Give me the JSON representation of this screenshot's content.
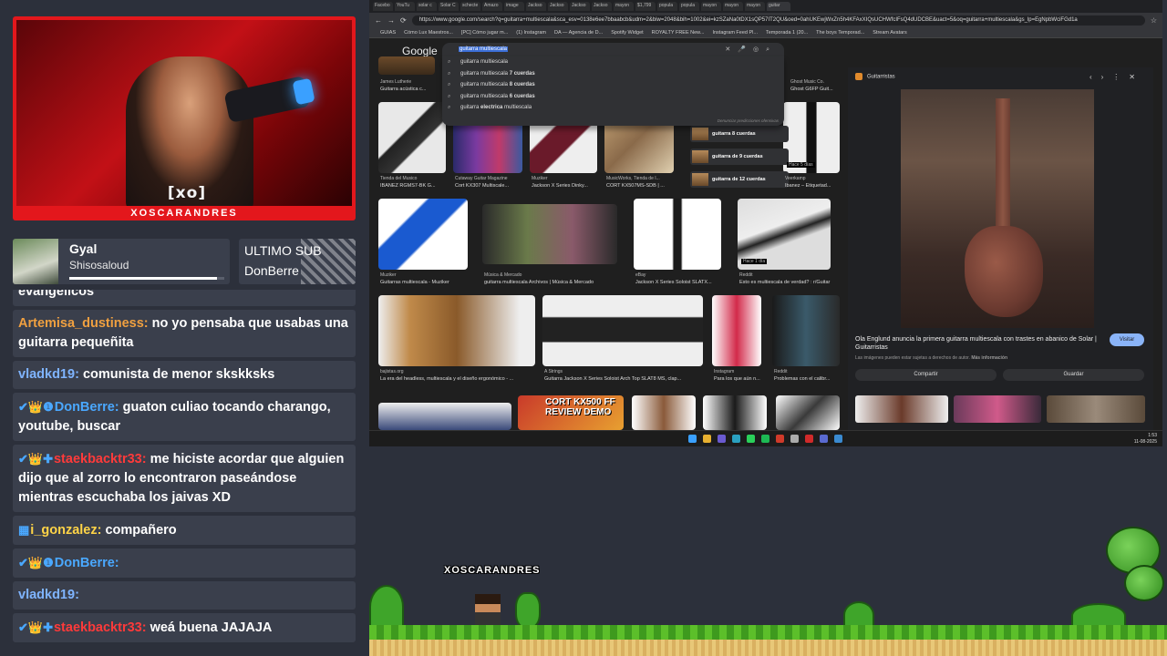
{
  "webcam": {
    "logo": "[xo]",
    "channel_name": "XOSCARANDRES"
  },
  "follow": {
    "label": "Gyal",
    "name": "Shisosaloud",
    "progress": 0.95
  },
  "last_sub": {
    "title": "ULTIMO SUB",
    "name": "DonBerre"
  },
  "chat": [
    {
      "user": "",
      "text": "evangelicos",
      "color": "#ffffff",
      "badges": ""
    },
    {
      "user": "Artemisa_dustiness:",
      "text": "no yo pensaba que usabas una guitarra pequeñita",
      "color": "#f0a040",
      "badges": ""
    },
    {
      "user": "vladkd19:",
      "text": "comunista de menor skskksks",
      "color": "#7fb4ff",
      "badges": ""
    },
    {
      "user": "DonBerre:",
      "text": "guaton culiao tocando charango, youtube, buscar",
      "color": "#4aa8ff",
      "badges": "✔👑❶"
    },
    {
      "user": "staekbacktr33:",
      "text": "me hiciste acordar que alguien dijo que al zorro lo encontraron paseándose mientras escuchaba los jaivas XD",
      "color": "#ff3a3a",
      "badges": "✔👑✚"
    },
    {
      "user": "i_gonzalez:",
      "text": "compañero",
      "color": "#ffd447",
      "badges": "▦"
    },
    {
      "user": "DonBerre:",
      "text": "",
      "color": "#4aa8ff",
      "badges": "✔👑❶"
    },
    {
      "user": "vladkd19:",
      "text": "",
      "color": "#7fb4ff",
      "badges": ""
    },
    {
      "user": "staekbacktr33:",
      "text": "weá buena JAJAJA",
      "color": "#ff3a3a",
      "badges": "✔👑✚"
    }
  ],
  "browser": {
    "tabs": [
      "Facebo",
      "YouTu",
      "solar c",
      "Solar C",
      "schecte",
      "Amazo",
      "image",
      "Jackso",
      "Jackso",
      "Jackso",
      "Jackso",
      "mayon",
      "$1,799",
      "popula",
      "popula",
      "mayon",
      "mayon",
      "mayon",
      "guitar"
    ],
    "url": "https://www.google.com/search?q=guitarra+multiescala&sca_esv=0138e6ee7bbaabcb&udm=2&biw=2048&bih=1002&ei=kzSZaNa0tDX1sQP57IT2QU&oed=0ahUKEwjWxZn5h4KFAxXIQsUCHWfcIFsQ4dUDCBE&uact=5&oq=guitarra+multiescala&gs_lp=EgNpbWciFGd1a",
    "bookmarks": [
      "GUIAS",
      "Cómo Lux Maestros...",
      "[PC] Cómo jugar m...",
      "(1) Instagram",
      "DA — Agencia de D...",
      "Spotify Widget",
      "ROYALTY FREE New...",
      "Instagram Feed Pl...",
      "Temporada 1 (20...",
      "The boys Temporad...",
      "Stream Avatars"
    ],
    "google_logo": "Google",
    "query": "guitarra multiescala",
    "suggestions": [
      {
        "pre": "guitarra multiescala",
        "bold": ""
      },
      {
        "pre": "guitarra multiescala ",
        "bold": "7 cuerdas"
      },
      {
        "pre": "guitarra multiescala ",
        "bold": "8 cuerdas"
      },
      {
        "pre": "guitarra multiescala ",
        "bold": "6 cuerdas"
      },
      {
        "pre": "guitarra ",
        "bold": "electrica",
        "post": " multiescala"
      }
    ],
    "suggestion_footer": "Denunciar predicciones ofensivas",
    "side_chips": [
      "guitarra 8 cuerdas",
      "guitarra de 9 cuerdas",
      "guitarra de 12 cuerdas"
    ],
    "results": [
      {
        "source": "James Lutherie",
        "title": "Guitarra acústica c..."
      },
      {
        "source": "Ghost Music Co.",
        "title": "Ghost G6FP Guit..."
      },
      {
        "source": "Tienda del Musico",
        "title": "IBANEZ RGMS7-BK G..."
      },
      {
        "source": "Cutaway Guitar Magazine",
        "title": "Cort KX307 Multiscale..."
      },
      {
        "source": "Muziker",
        "title": "Jackson X Series Dinky..."
      },
      {
        "source": "MusicWorks, Tienda de I...",
        "title": "CORT KX507MS-SDB | ..."
      },
      {
        "source": "Veerkamp",
        "title": "Ibanez – Etiquetad..."
      },
      {
        "source": "Muziker",
        "title": "Guitarras multiescala - Muziker"
      },
      {
        "source": "Música & Mercado",
        "title": "guitarra multiescala Archivos | Música & Mercado"
      },
      {
        "source": "eBay",
        "title": "Jackson X Series Soloist SLATX..."
      },
      {
        "source": "Reddit",
        "title": "Esto es multiescala de verdad? : r/Guitar"
      },
      {
        "source": "bajistas.org",
        "title": "La era del headless, multiescala y el diseño ergonómico - ..."
      },
      {
        "source": "A Strings",
        "title": "Guitarra Jackson X Series Soloist Arch Top SLAT8 MS, clap..."
      },
      {
        "source": "Instagram",
        "title": "Para los que aún n..."
      },
      {
        "source": "Reddit",
        "title": "Problemas con el calibr..."
      }
    ],
    "badges": [
      "Hace 5 días",
      "Hace 1 día"
    ],
    "banner": "CORT KX500 FF REVIEW DEMO",
    "panel": {
      "source": "Guitarristas",
      "title": "Ola Englund anuncia la primera guitarra multiescala con trastes en abanico de Solar | Guitarristas",
      "note": "Las imágenes pueden estar sujetas a derechos de autor.",
      "more_info": "Más información",
      "visit": "Visitar",
      "share": "Compartir",
      "save": "Guardar"
    },
    "clock": {
      "time": "1:53",
      "date": "11-08-2025"
    }
  },
  "game": {
    "player_name": "XOSCARANDRES"
  },
  "colors": {
    "cam_red": "#e3171c",
    "chat_bg": "#3a3f4c",
    "accent_blue": "#8ab4f8"
  }
}
